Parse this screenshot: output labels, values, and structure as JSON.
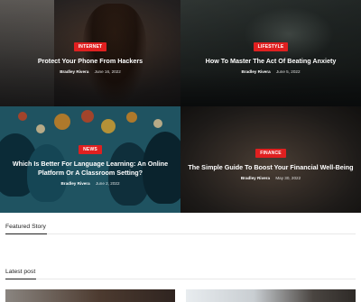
{
  "tiles": [
    {
      "category": "Internet",
      "title": "Protect Your Phone From Hackers",
      "author": "Bradley Rivera",
      "date": "June 16, 2022"
    },
    {
      "category": "Lifestyle",
      "title": "How To Master The Act Of Beating Anxiety",
      "author": "Bradley Rivera",
      "date": "June 5, 2022"
    },
    {
      "category": "News",
      "title_line1": "Which Is Better For Language Learning: An Online",
      "title_line2": "Platform Or A Classroom Setting?",
      "author": "Bradley Rivera",
      "date": "June 2, 2022"
    },
    {
      "category": "Finance",
      "title": "The Simple Guide To Boost Your Financial Well-Being",
      "author": "Bradley Rivera",
      "date": "May 30, 2022"
    }
  ],
  "sections": {
    "featured": "Featured Story",
    "latest": "Latest post"
  },
  "colors": {
    "badge": "#e02020",
    "heads_background": "#2a6f82"
  }
}
